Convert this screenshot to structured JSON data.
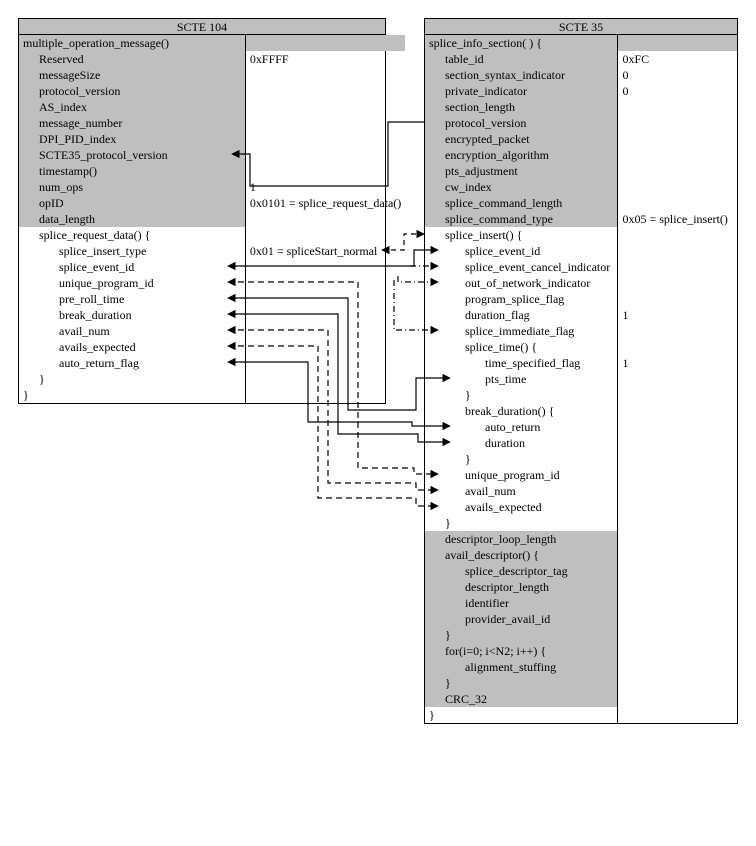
{
  "left": {
    "title": "SCTE 104",
    "fn": "multiple_operation_message()",
    "rows": [
      {
        "key": "Reserved",
        "val": "0xFFFF"
      },
      {
        "key": "messageSize",
        "val": ""
      },
      {
        "key": "protocol_version",
        "val": ""
      },
      {
        "key": "AS_index",
        "val": ""
      },
      {
        "key": "message_number",
        "val": ""
      },
      {
        "key": "DPI_PID_index",
        "val": ""
      },
      {
        "key": "SCTE35_protocol_version",
        "val": ""
      },
      {
        "key": "timestamp()",
        "val": ""
      },
      {
        "key": "num_ops",
        "val": "1"
      },
      {
        "key": "opID",
        "val": "0x0101 = splice_request_data()"
      },
      {
        "key": "data_length",
        "val": ""
      }
    ],
    "sub_open": "splice_request_data() {",
    "sub": [
      {
        "key": "splice_insert_type",
        "val": "0x01 = spliceStart_normal"
      },
      {
        "key": "splice_event_id",
        "val": ""
      },
      {
        "key": "unique_program_id",
        "val": ""
      },
      {
        "key": "pre_roll_time",
        "val": ""
      },
      {
        "key": "break_duration",
        "val": ""
      },
      {
        "key": "avail_num",
        "val": ""
      },
      {
        "key": "avails_expected",
        "val": ""
      },
      {
        "key": "auto_return_flag",
        "val": ""
      }
    ],
    "sub_close": "}",
    "close": "}"
  },
  "right": {
    "title": "SCTE 35",
    "fn": "splice_info_section( ) {",
    "head": [
      {
        "key": "table_id",
        "val": "0xFC"
      },
      {
        "key": "section_syntax_indicator",
        "val": "0"
      },
      {
        "key": "private_indicator",
        "val": "0"
      },
      {
        "key": "section_length",
        "val": ""
      },
      {
        "key": "protocol_version",
        "val": ""
      },
      {
        "key": "encrypted_packet",
        "val": ""
      },
      {
        "key": "encryption_algorithm",
        "val": ""
      },
      {
        "key": "pts_adjustment",
        "val": ""
      },
      {
        "key": "cw_index",
        "val": ""
      },
      {
        "key": "splice_command_length",
        "val": ""
      },
      {
        "key": "splice_command_type",
        "val": "0x05 = splice_insert()"
      }
    ],
    "si_open": "splice_insert() {",
    "si": [
      {
        "key": "splice_event_id",
        "val": ""
      },
      {
        "key": "splice_event_cancel_indicator",
        "val": ""
      },
      {
        "key": "out_of_network_indicator",
        "val": ""
      },
      {
        "key": "program_splice_flag",
        "val": ""
      },
      {
        "key": "duration_flag",
        "val": "1"
      },
      {
        "key": "splice_immediate_flag",
        "val": ""
      }
    ],
    "st_open": "splice_time() {",
    "st": [
      {
        "key": "time_specified_flag",
        "val": "1"
      },
      {
        "key": "pts_time",
        "val": ""
      }
    ],
    "st_close": "}",
    "bd_open": "break_duration() {",
    "bd": [
      {
        "key": "auto_return",
        "val": ""
      },
      {
        "key": "duration",
        "val": ""
      }
    ],
    "bd_close": "}",
    "tail3": [
      {
        "key": "unique_program_id",
        "val": ""
      },
      {
        "key": "avail_num",
        "val": ""
      },
      {
        "key": "avails_expected",
        "val": ""
      }
    ],
    "si_close": "}",
    "foot": [
      "descriptor_loop_length",
      "avail_descriptor() {",
      "splice_descriptor_tag",
      "descriptor_length",
      "identifier",
      "provider_avail_id",
      "}",
      "for(i=0; i<N2; i++) {",
      "alignment_stuffing",
      "}",
      "CRC_32"
    ],
    "close": "}"
  }
}
